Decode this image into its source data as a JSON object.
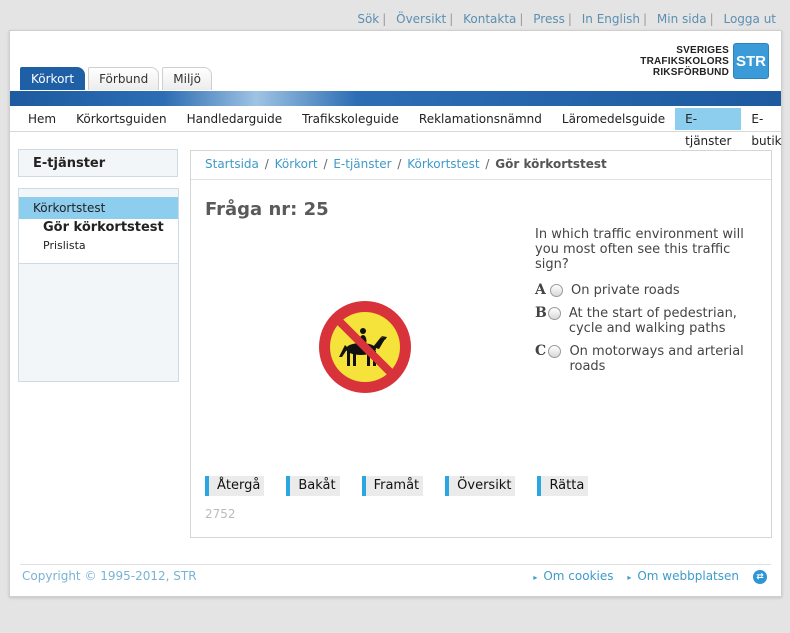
{
  "top_links": [
    "Sök",
    "Översikt",
    "Kontakta",
    "Press",
    "In English",
    "Min sida",
    "Logga ut"
  ],
  "top_sep": "|",
  "logo": {
    "line1": "SVERIGES",
    "line2": "TRAFIKSKOLORS",
    "line3": "RIKSFÖRBUND",
    "mark": "STR"
  },
  "tabs": [
    "Körkort",
    "Förbund",
    "Miljö"
  ],
  "nav": [
    "Hem",
    "Körkortsguiden",
    "Handledarguide",
    "Trafikskoleguide",
    "Reklamationsnämnd",
    "Läromedelsguide",
    "E-tjänster",
    "E-butik"
  ],
  "sidebar": {
    "title": "E-tjänster",
    "selected": "Körkortstest",
    "sub1": "Gör körkortstest",
    "sub2": "Prislista"
  },
  "breadcrumb": {
    "items": [
      "Startsida",
      "Körkort",
      "E-tjänster",
      "Körkortstest"
    ],
    "current": "Gör körkortstest",
    "sep": "/"
  },
  "question": {
    "title": "Fråga nr: 25",
    "text": "In which traffic environment will you most often see this traffic sign?",
    "answers": [
      {
        "letter": "A",
        "text": "On private roads"
      },
      {
        "letter": "B",
        "text": "At the start of pedestrian, cycle and walking paths"
      },
      {
        "letter": "C",
        "text": "On motorways and arterial roads"
      }
    ],
    "id": "2752",
    "sign_icon": "no-horse-riding-sign"
  },
  "buttons": [
    "Återgå",
    "Bakåt",
    "Framåt",
    "Översikt",
    "Rätta"
  ],
  "footer": {
    "copyright": "Copyright © 1995-2012, STR",
    "links": [
      "Om cookies",
      "Om webbplatsen"
    ]
  },
  "colors": {
    "accent": "#3f9ac9",
    "nav_active": "#8dcdee",
    "brand_blue": "#1f5fa6"
  }
}
